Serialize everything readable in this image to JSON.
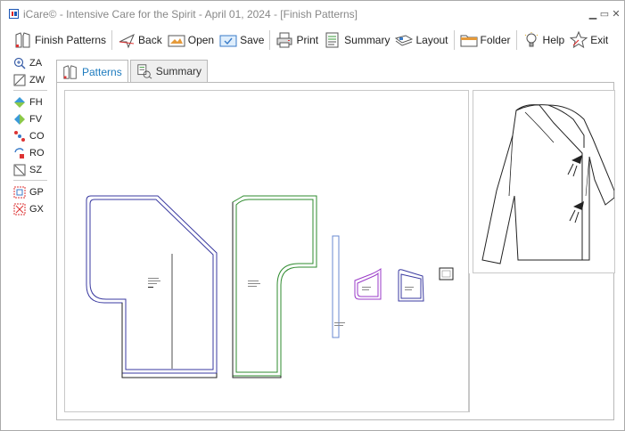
{
  "window": {
    "title": "iCare© - Intensive Care for the Spirit - April 01, 2024 - [Finish Patterns]",
    "controls": [
      "▁",
      "▭",
      "✕"
    ]
  },
  "toolbar": {
    "items": [
      {
        "label": "Finish Patterns",
        "icon": "finish-patterns-icon"
      },
      {
        "label": "Back",
        "icon": "back-icon"
      },
      {
        "label": "Open",
        "icon": "open-icon"
      },
      {
        "label": "Save",
        "icon": "save-icon"
      },
      {
        "label": "Print",
        "icon": "print-icon"
      },
      {
        "label": "Summary",
        "icon": "summary-icon"
      },
      {
        "label": "Layout",
        "icon": "layout-icon"
      },
      {
        "label": "Folder",
        "icon": "folder-icon"
      },
      {
        "label": "Help",
        "icon": "help-icon"
      },
      {
        "label": "Exit",
        "icon": "exit-icon"
      }
    ]
  },
  "sidetools": {
    "items": [
      {
        "label": "ZA",
        "icon": "zoom-all-icon"
      },
      {
        "label": "ZW",
        "icon": "zoom-window-icon"
      },
      {
        "label": "FH",
        "icon": "flip-horizontal-icon"
      },
      {
        "label": "FV",
        "icon": "flip-vertical-icon"
      },
      {
        "label": "CO",
        "icon": "copy-icon"
      },
      {
        "label": "RO",
        "icon": "rotate-icon"
      },
      {
        "label": "SZ",
        "icon": "size-icon"
      },
      {
        "label": "GP",
        "icon": "group-icon"
      },
      {
        "label": "GX",
        "icon": "ungroup-icon"
      }
    ]
  },
  "tabs": [
    {
      "label": "Patterns",
      "active": true
    },
    {
      "label": "Summary",
      "active": false
    }
  ],
  "colors": {
    "accent": "#1d7bbf",
    "back_piece": "#3a3aa0",
    "front_piece": "#2e8b2e",
    "strip": "#6a8ad0",
    "pocket_a": "#9a3ac8",
    "pocket_b": "#3a3aa0"
  }
}
